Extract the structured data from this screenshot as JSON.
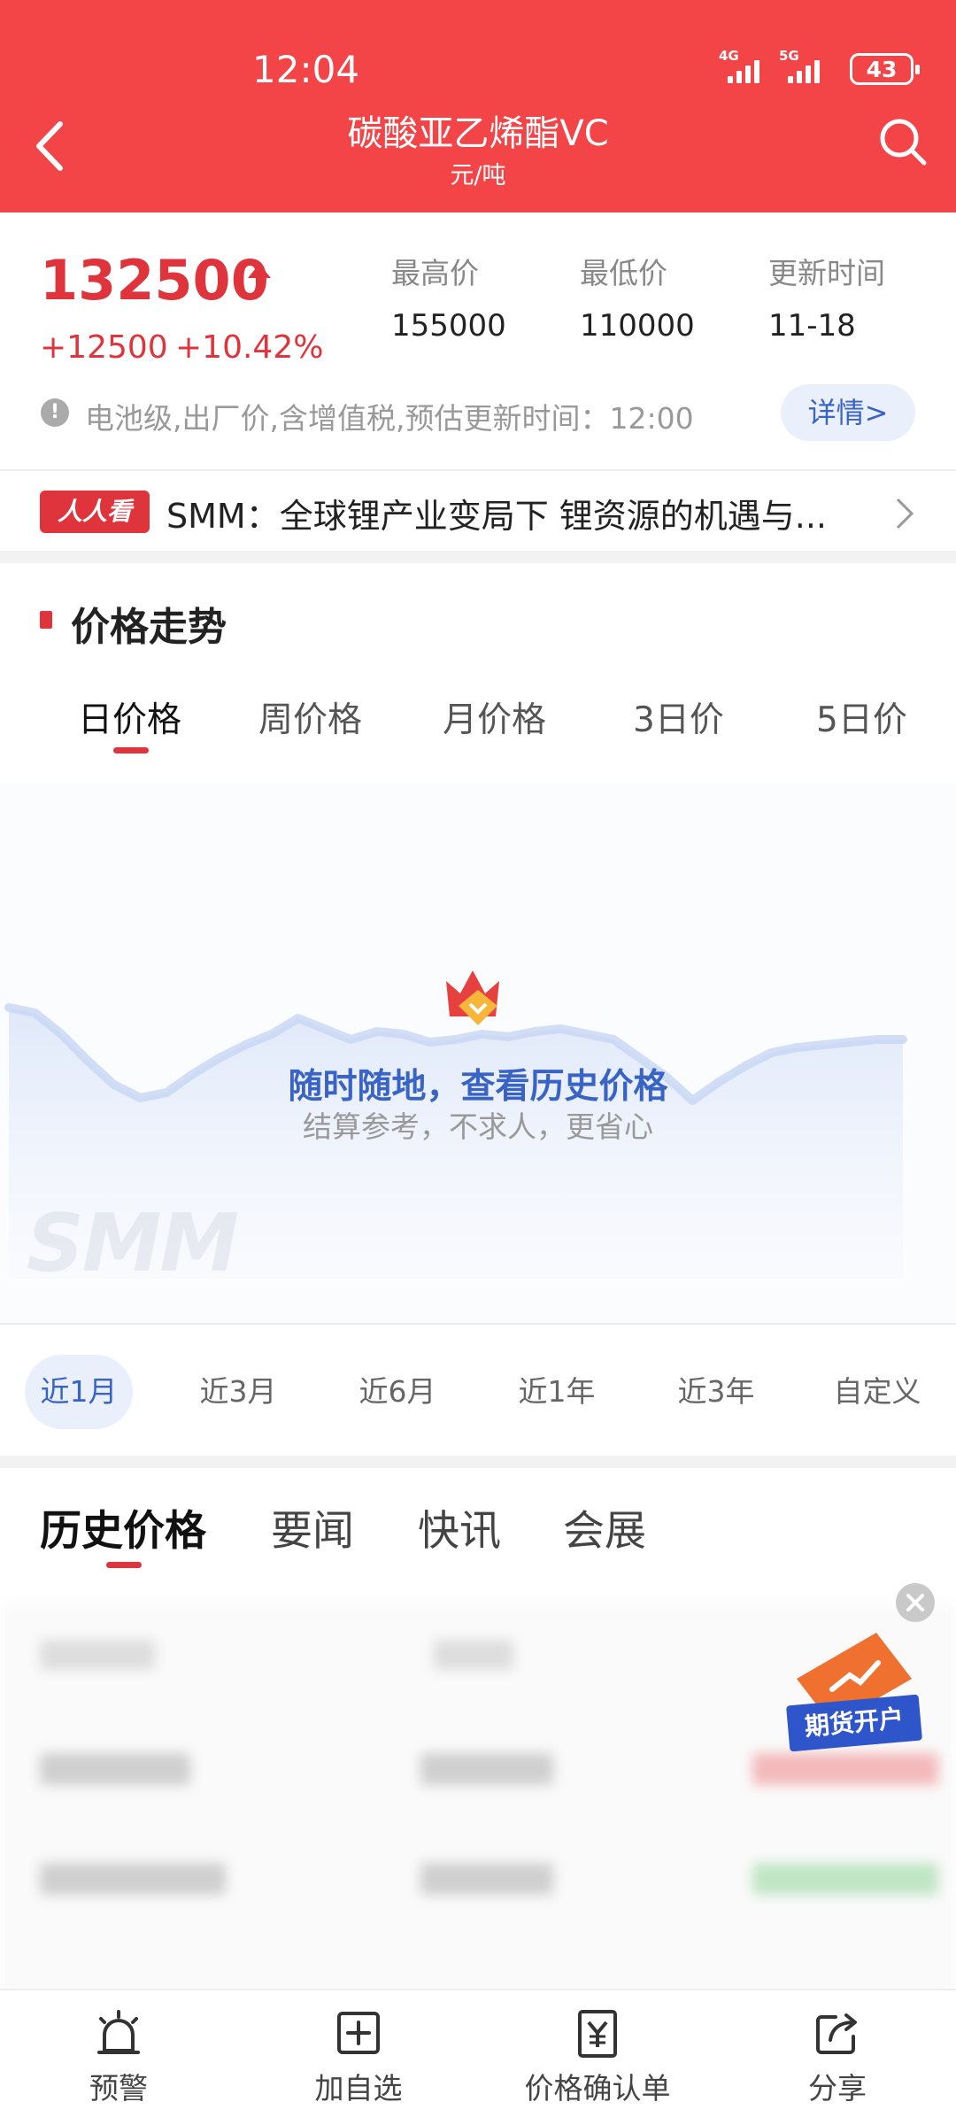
{
  "status_bar": {
    "time": "12:04",
    "net1": "4G",
    "net2": "5G",
    "battery": "43"
  },
  "header": {
    "title": "碳酸亚乙烯酯VC",
    "unit": "元/吨"
  },
  "price": {
    "current": "132500",
    "change": "+12500",
    "change_pct": "+10.42%",
    "stats": [
      {
        "label": "最高价",
        "value": "155000"
      },
      {
        "label": "最低价",
        "value": "110000"
      },
      {
        "label": "更新时间",
        "value": "11-18"
      }
    ],
    "note": "电池级,出厂价,含增值税,预估更新时间：12:00",
    "detail_label": "详情>"
  },
  "news": {
    "badge": "人人看",
    "headline": "SMM：全球锂产业变局下 锂资源的机遇与..."
  },
  "section": {
    "title": "价格走势",
    "tabs": [
      "日价格",
      "周价格",
      "月价格",
      "3日价",
      "5日价"
    ]
  },
  "chart": {
    "promo_title": "随时随地，查看历史价格",
    "promo_sub": "结算参考，不求人，更省心",
    "watermark": "SMM"
  },
  "chart_data": {
    "type": "area",
    "y": [
      92,
      90,
      82,
      72,
      63,
      58,
      60,
      67,
      73,
      78,
      82,
      88,
      84,
      80,
      83,
      82,
      79,
      80,
      82,
      81,
      83,
      84,
      82,
      80,
      73,
      66,
      57,
      64,
      70,
      75,
      77,
      78,
      79,
      80,
      80
    ]
  },
  "ranges": [
    "近1月",
    "近3月",
    "近6月",
    "近1年",
    "近3年",
    "自定义"
  ],
  "content_tabs": [
    "历史价格",
    "要闻",
    "快讯",
    "会展"
  ],
  "float_ad": {
    "label": "期货开户"
  },
  "bottom_nav": [
    {
      "label": "预警",
      "icon": "alarm-icon"
    },
    {
      "label": "加自选",
      "icon": "add-watchlist-icon"
    },
    {
      "label": "价格确认单",
      "icon": "price-receipt-icon"
    },
    {
      "label": "分享",
      "icon": "share-icon"
    }
  ],
  "colors": {
    "brand_red": "#f34548",
    "accent_blue": "#3a63c6"
  }
}
